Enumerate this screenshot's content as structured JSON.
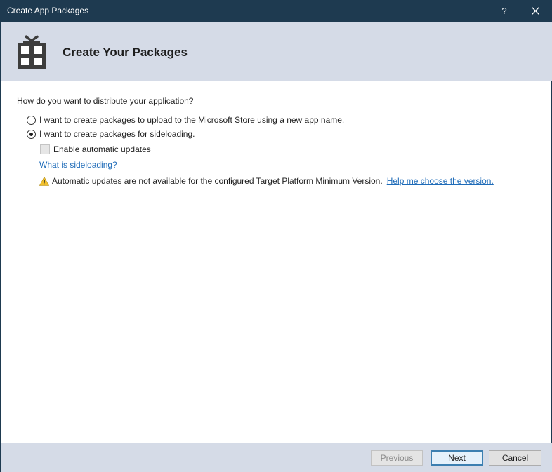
{
  "window": {
    "title": "Create App Packages",
    "help_label": "?",
    "close_icon": "close-icon",
    "titlebar_color": "#1e3a50"
  },
  "banner": {
    "icon": "gift-box-icon",
    "heading": "Create Your Packages",
    "background": "#d5dbe7"
  },
  "main": {
    "question": "How do you want to distribute your application?",
    "options": [
      {
        "label": "I want to create packages to upload to the Microsoft Store using a new app name.",
        "selected": false
      },
      {
        "label": "I want to create packages for sideloading.",
        "selected": true
      }
    ],
    "auto_update": {
      "label": "Enable automatic updates",
      "checked": false,
      "enabled": false
    },
    "what_link": "What is sideloading?",
    "warning": {
      "icon": "warning-icon",
      "text": "Automatic updates are not available for the configured Target Platform Minimum Version.",
      "link": "Help me choose the version."
    },
    "link_color": "#1e6bb8"
  },
  "footer": {
    "previous_label": "Previous",
    "previous_enabled": false,
    "next_label": "Next",
    "cancel_label": "Cancel"
  }
}
